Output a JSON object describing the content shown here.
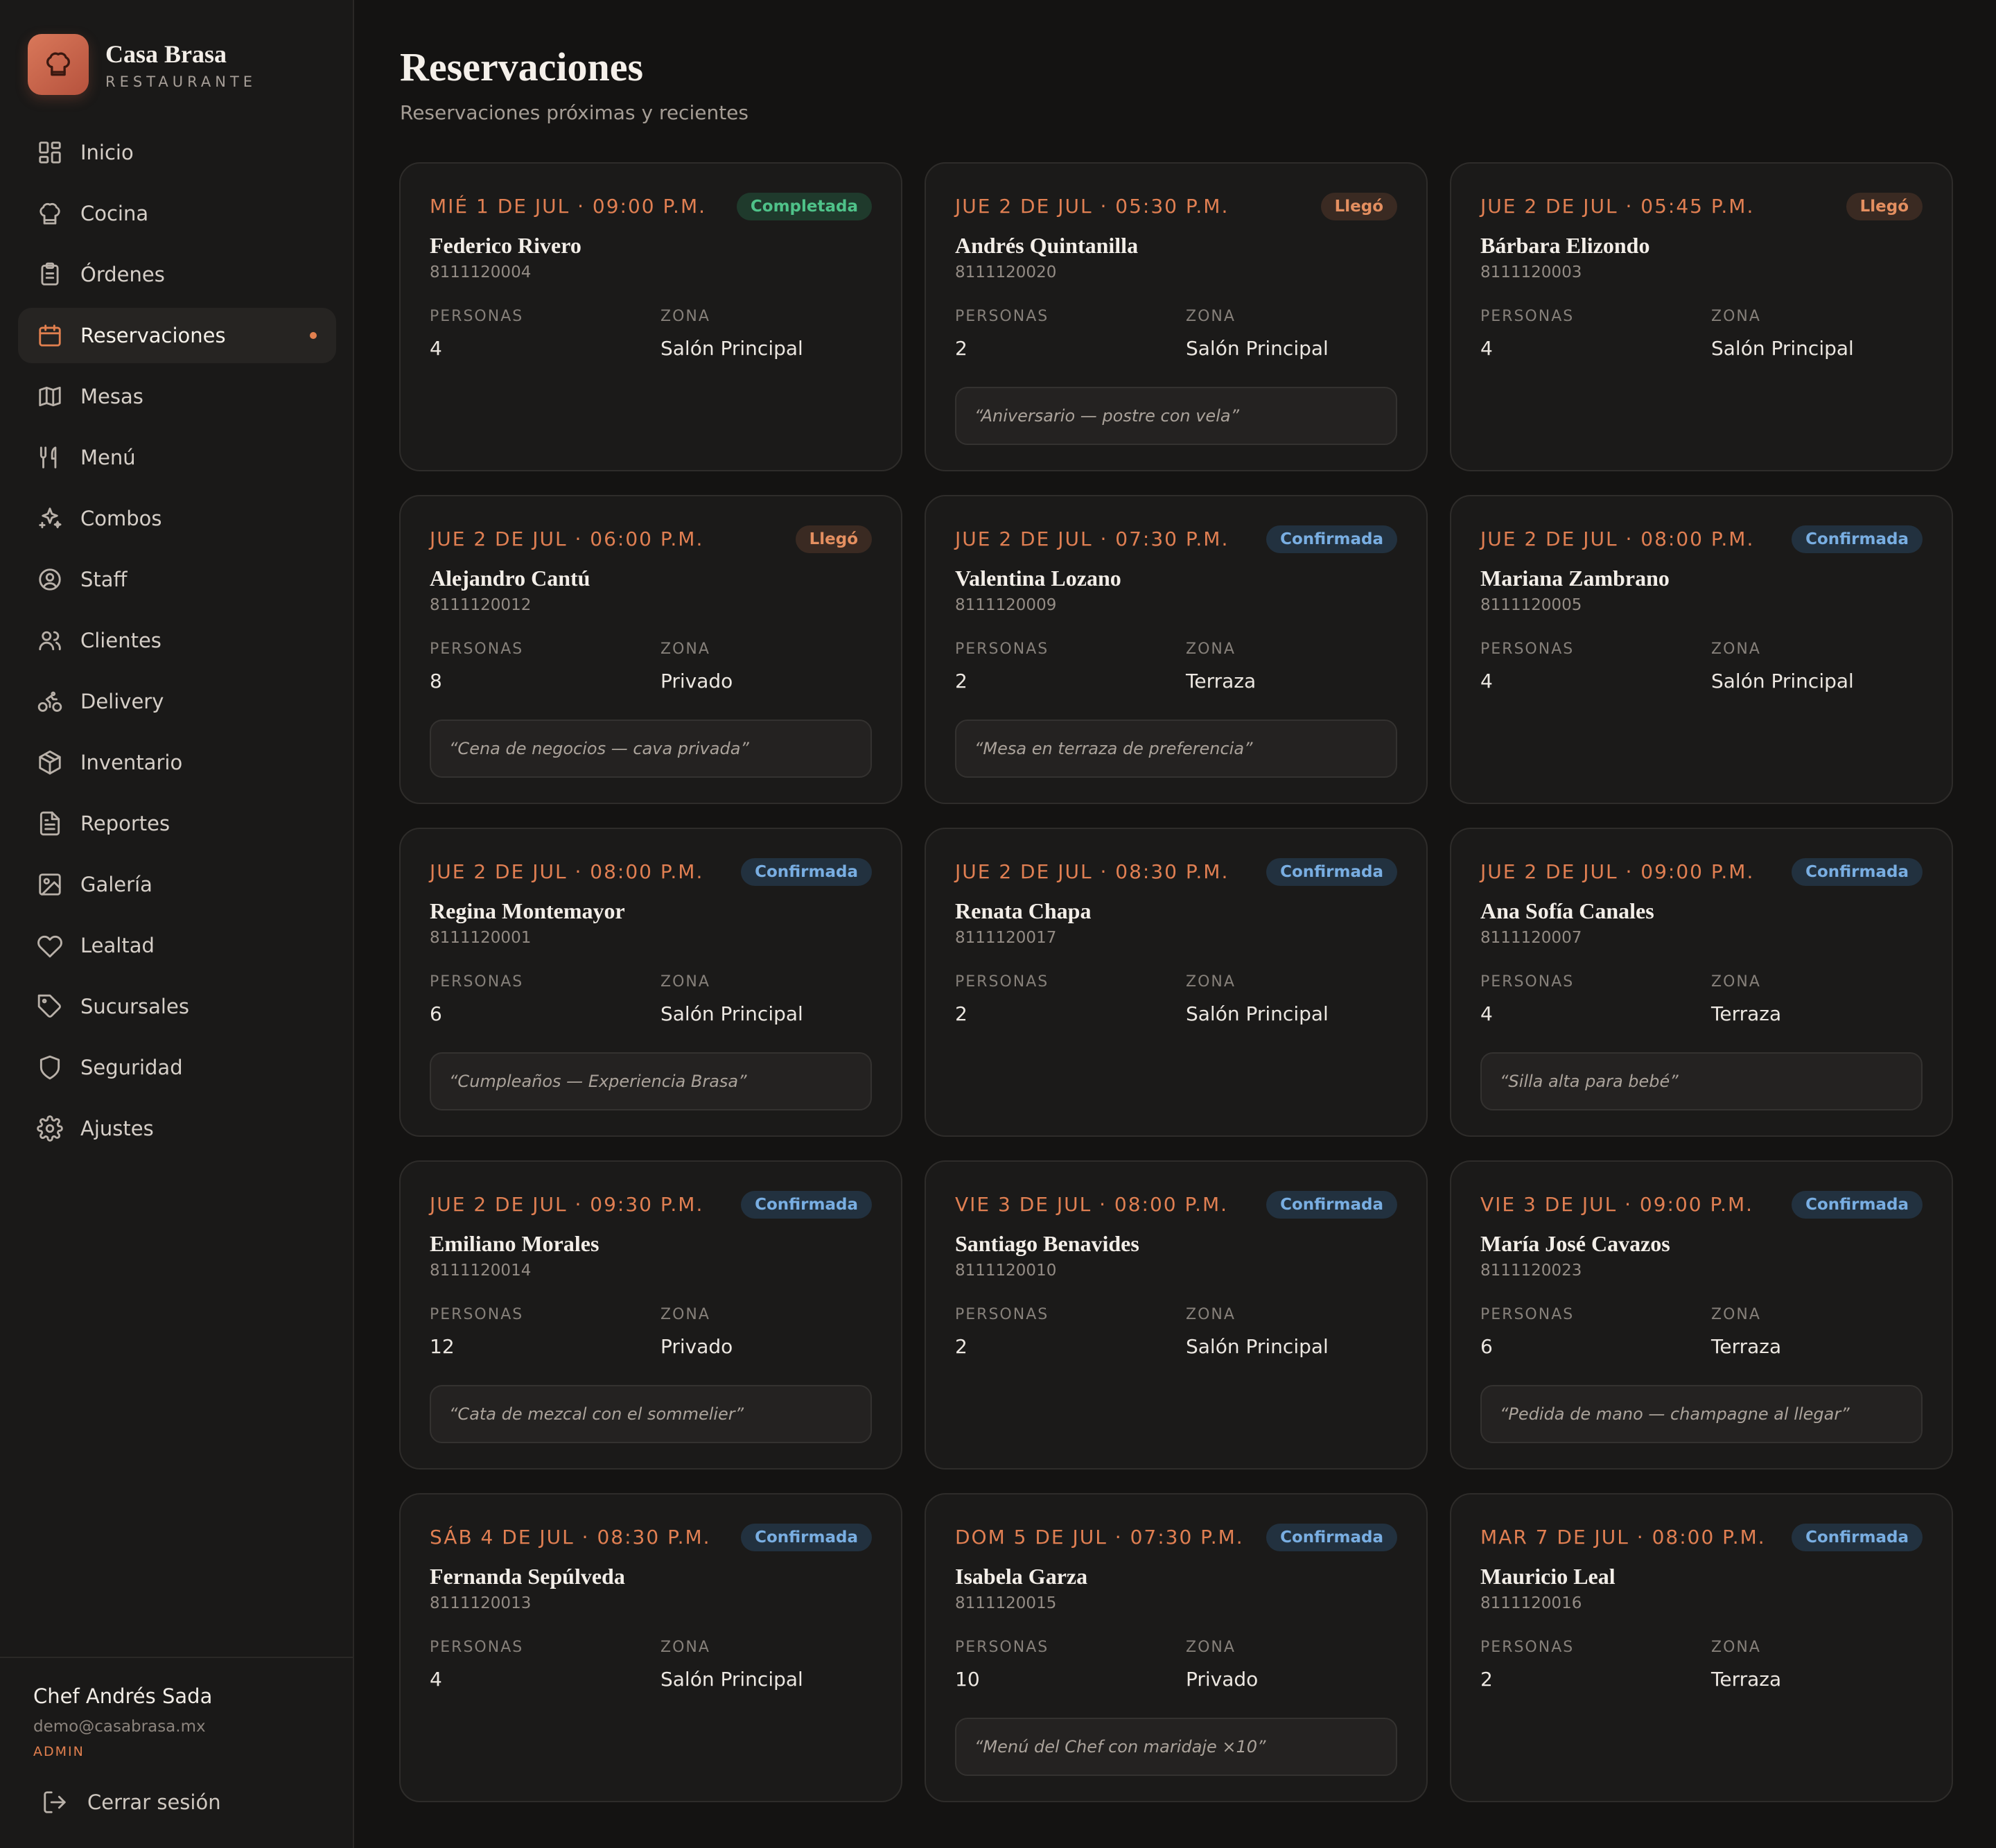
{
  "brand": {
    "name": "Casa Brasa",
    "subtitle": "RESTAURANTE"
  },
  "nav": [
    {
      "label": "Inicio",
      "icon": "dashboard-icon"
    },
    {
      "label": "Cocina",
      "icon": "chef-hat-icon"
    },
    {
      "label": "Órdenes",
      "icon": "clipboard-icon"
    },
    {
      "label": "Reservaciones",
      "icon": "calendar-icon",
      "active": true
    },
    {
      "label": "Mesas",
      "icon": "map-icon"
    },
    {
      "label": "Menú",
      "icon": "utensils-icon"
    },
    {
      "label": "Combos",
      "icon": "sparkles-icon"
    },
    {
      "label": "Staff",
      "icon": "user-circle-icon"
    },
    {
      "label": "Clientes",
      "icon": "users-icon"
    },
    {
      "label": "Delivery",
      "icon": "bike-icon"
    },
    {
      "label": "Inventario",
      "icon": "package-icon"
    },
    {
      "label": "Reportes",
      "icon": "file-text-icon"
    },
    {
      "label": "Galería",
      "icon": "image-icon"
    },
    {
      "label": "Lealtad",
      "icon": "heart-icon"
    },
    {
      "label": "Sucursales",
      "icon": "tag-icon"
    },
    {
      "label": "Seguridad",
      "icon": "shield-icon"
    },
    {
      "label": "Ajustes",
      "icon": "gear-icon"
    }
  ],
  "user": {
    "name": "Chef Andrés Sada",
    "email": "demo@casabrasa.mx",
    "role": "ADMIN"
  },
  "logout_label": "Cerrar sesión",
  "page": {
    "title": "Reservaciones",
    "subtitle": "Reservaciones próximas y recientes"
  },
  "labels": {
    "personas": "PERSONAS",
    "zona": "ZONA"
  },
  "colors": {
    "accent": "#e2804f",
    "completada": "#4fc289",
    "llego": "#e48f60",
    "confirmada": "#79aee2"
  },
  "reservations": [
    {
      "date": "MIÉ 1 DE JUL · 09:00 P.M.",
      "status": "Completada",
      "status_kind": "completada",
      "name": "Federico Rivero",
      "phone": "8111120004",
      "personas": "4",
      "zona": "Salón Principal",
      "note": ""
    },
    {
      "date": "JUE 2 DE JUL · 05:30 P.M.",
      "status": "Llegó",
      "status_kind": "llego",
      "name": "Andrés Quintanilla",
      "phone": "8111120020",
      "personas": "2",
      "zona": "Salón Principal",
      "note": "“Aniversario — postre con vela”"
    },
    {
      "date": "JUE 2 DE JUL · 05:45 P.M.",
      "status": "Llegó",
      "status_kind": "llego",
      "name": "Bárbara Elizondo",
      "phone": "8111120003",
      "personas": "4",
      "zona": "Salón Principal",
      "note": ""
    },
    {
      "date": "JUE 2 DE JUL · 06:00 P.M.",
      "status": "Llegó",
      "status_kind": "llego",
      "name": "Alejandro Cantú",
      "phone": "8111120012",
      "personas": "8",
      "zona": "Privado",
      "note": "“Cena de negocios — cava privada”"
    },
    {
      "date": "JUE 2 DE JUL · 07:30 P.M.",
      "status": "Confirmada",
      "status_kind": "confirmada",
      "name": "Valentina Lozano",
      "phone": "8111120009",
      "personas": "2",
      "zona": "Terraza",
      "note": "“Mesa en terraza de preferencia”"
    },
    {
      "date": "JUE 2 DE JUL · 08:00 P.M.",
      "status": "Confirmada",
      "status_kind": "confirmada",
      "name": "Mariana Zambrano",
      "phone": "8111120005",
      "personas": "4",
      "zona": "Salón Principal",
      "note": ""
    },
    {
      "date": "JUE 2 DE JUL · 08:00 P.M.",
      "status": "Confirmada",
      "status_kind": "confirmada",
      "name": "Regina Montemayor",
      "phone": "8111120001",
      "personas": "6",
      "zona": "Salón Principal",
      "note": "“Cumpleaños — Experiencia Brasa”"
    },
    {
      "date": "JUE 2 DE JUL · 08:30 P.M.",
      "status": "Confirmada",
      "status_kind": "confirmada",
      "name": "Renata Chapa",
      "phone": "8111120017",
      "personas": "2",
      "zona": "Salón Principal",
      "note": ""
    },
    {
      "date": "JUE 2 DE JUL · 09:00 P.M.",
      "status": "Confirmada",
      "status_kind": "confirmada",
      "name": "Ana Sofía Canales",
      "phone": "8111120007",
      "personas": "4",
      "zona": "Terraza",
      "note": "“Silla alta para bebé”"
    },
    {
      "date": "JUE 2 DE JUL · 09:30 P.M.",
      "status": "Confirmada",
      "status_kind": "confirmada",
      "name": "Emiliano Morales",
      "phone": "8111120014",
      "personas": "12",
      "zona": "Privado",
      "note": "“Cata de mezcal con el sommelier”"
    },
    {
      "date": "VIE 3 DE JUL · 08:00 P.M.",
      "status": "Confirmada",
      "status_kind": "confirmada",
      "name": "Santiago Benavides",
      "phone": "8111120010",
      "personas": "2",
      "zona": "Salón Principal",
      "note": ""
    },
    {
      "date": "VIE 3 DE JUL · 09:00 P.M.",
      "status": "Confirmada",
      "status_kind": "confirmada",
      "name": "María José Cavazos",
      "phone": "8111120023",
      "personas": "6",
      "zona": "Terraza",
      "note": "“Pedida de mano — champagne al llegar”"
    },
    {
      "date": "SÁB 4 DE JUL · 08:30 P.M.",
      "status": "Confirmada",
      "status_kind": "confirmada",
      "name": "Fernanda Sepúlveda",
      "phone": "8111120013",
      "personas": "4",
      "zona": "Salón Principal",
      "note": ""
    },
    {
      "date": "DOM 5 DE JUL · 07:30 P.M.",
      "status": "Confirmada",
      "status_kind": "confirmada",
      "name": "Isabela Garza",
      "phone": "8111120015",
      "personas": "10",
      "zona": "Privado",
      "note": "“Menú del Chef con maridaje ×10”"
    },
    {
      "date": "MAR 7 DE JUL · 08:00 P.M.",
      "status": "Confirmada",
      "status_kind": "confirmada",
      "name": "Mauricio Leal",
      "phone": "8111120016",
      "personas": "2",
      "zona": "Terraza",
      "note": ""
    }
  ]
}
